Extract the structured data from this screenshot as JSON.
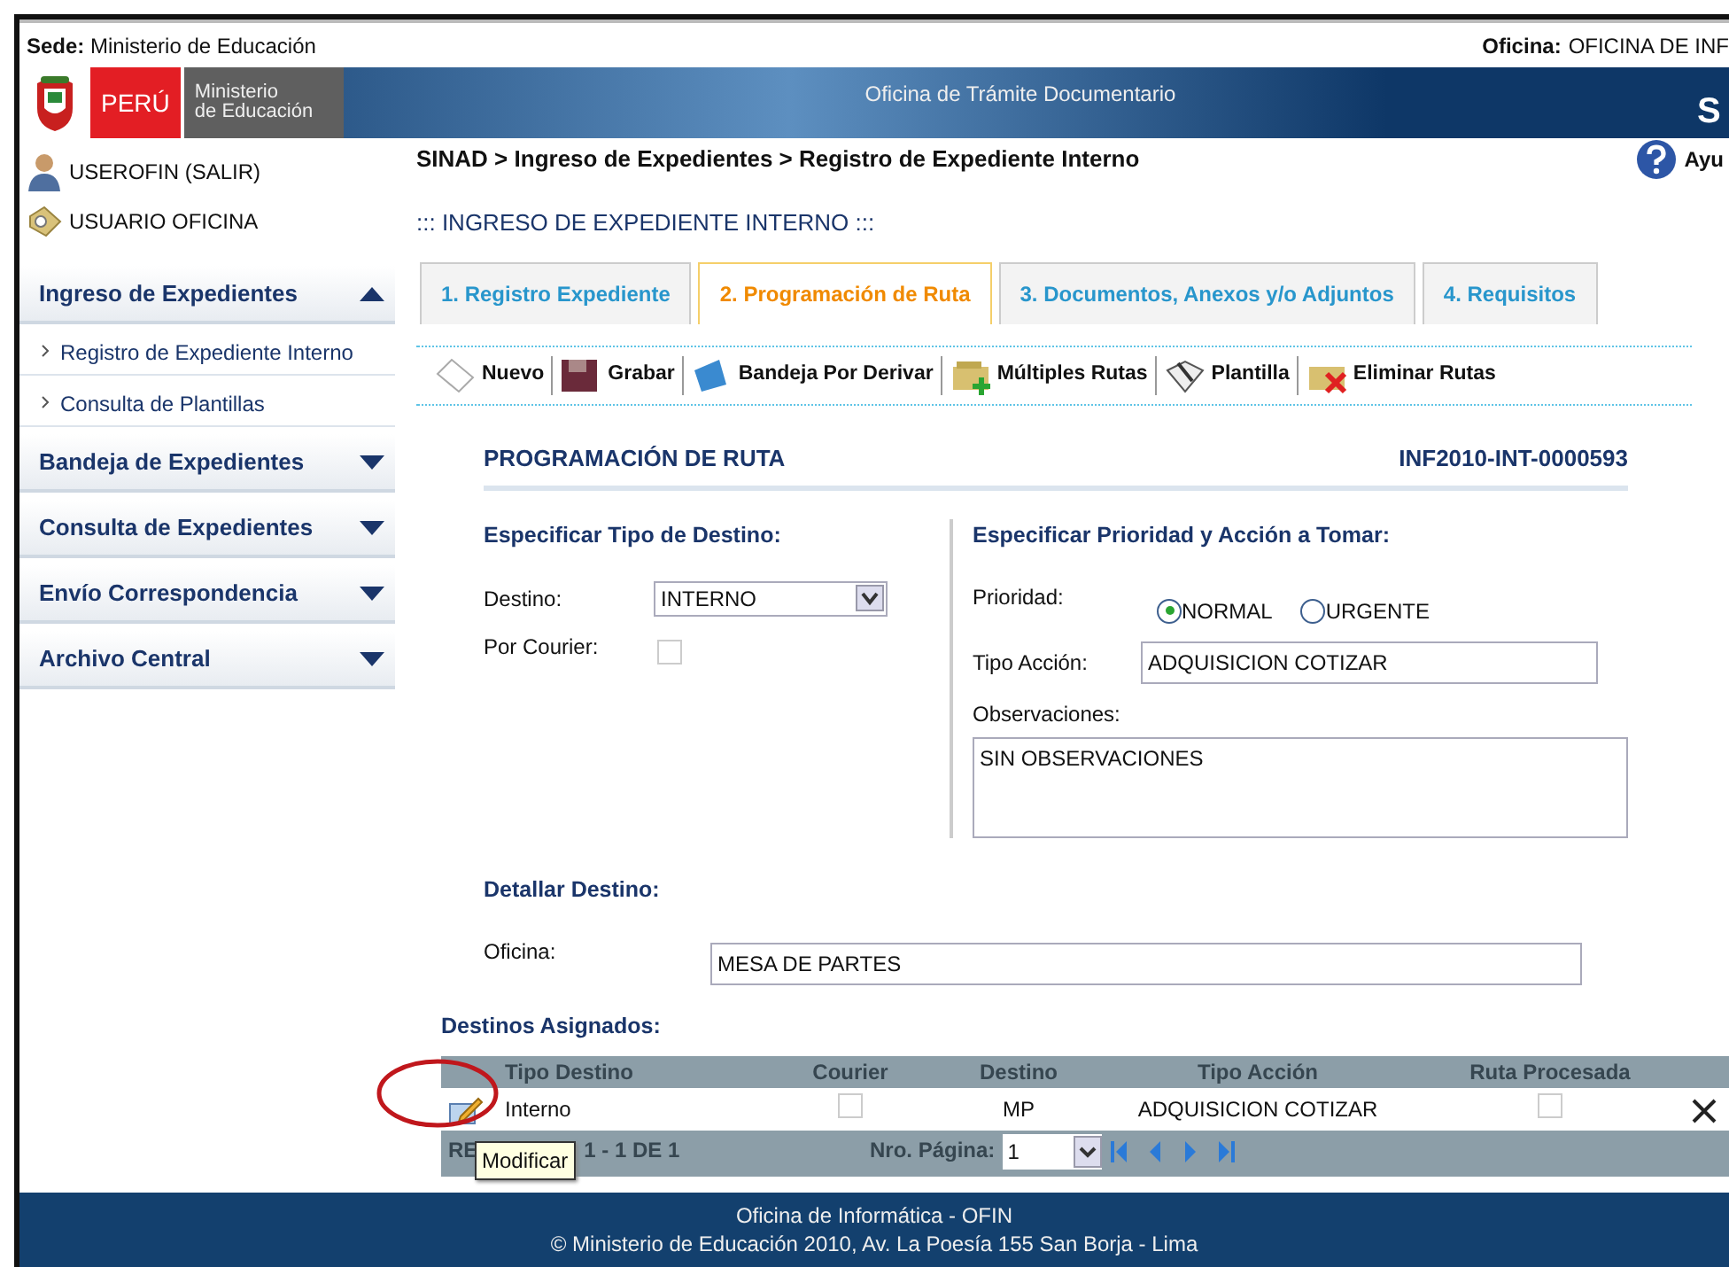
{
  "topbar": {
    "sede_label": "Sede:",
    "sede_value": "Ministerio de Educación",
    "oficina_label": "Oficina:",
    "oficina_value": "OFICINA DE INF"
  },
  "banner": {
    "country": "PERÚ",
    "ministry": [
      "Ministerio",
      "de Educación"
    ],
    "app_title": "Oficina de Trámite Documentario",
    "logo_letter": "S"
  },
  "sidebar": {
    "user_link": "USEROFIN (SALIR)",
    "role": "USUARIO OFICINA",
    "menu": [
      {
        "label": "Ingreso de Expedientes",
        "expanded": true,
        "children": [
          {
            "label": "Registro de Expediente Interno"
          },
          {
            "label": "Consulta de Plantillas"
          }
        ]
      },
      {
        "label": "Bandeja de Expedientes",
        "expanded": false
      },
      {
        "label": "Consulta de Expedientes",
        "expanded": false
      },
      {
        "label": "Envío Correspondencia",
        "expanded": false
      },
      {
        "label": "Archivo Central",
        "expanded": false
      }
    ]
  },
  "breadcrumb": "SINAD > Ingreso de Expedientes > Registro de Expediente Interno",
  "help_label": "Ayu",
  "page_title": "::: INGRESO DE EXPEDIENTE INTERNO :::",
  "tabs": [
    {
      "label": "1. Registro Expediente",
      "selected": false
    },
    {
      "label": "2. Programación de Ruta",
      "selected": true
    },
    {
      "label": "3. Documentos, Anexos y/o Adjuntos",
      "selected": false
    },
    {
      "label": "4. Requisitos",
      "selected": false
    }
  ],
  "toolbar": [
    {
      "kind": "new",
      "label": "Nuevo"
    },
    {
      "kind": "save",
      "label": "Grabar"
    },
    {
      "kind": "tray",
      "label": "Bandeja Por Derivar"
    },
    {
      "kind": "routes",
      "label": "Múltiples Rutas"
    },
    {
      "kind": "template",
      "label": "Plantilla"
    },
    {
      "kind": "delete",
      "label": "Eliminar Rutas"
    }
  ],
  "form": {
    "title": "PROGRAMACIÓN DE RUTA",
    "code": "INF2010-INT-0000593",
    "destino": {
      "heading": "Especificar Tipo de Destino:",
      "destino_label": "Destino:",
      "destino_value": "INTERNO",
      "courier_label": "Por Courier:",
      "courier_checked": false
    },
    "prioridad": {
      "heading": "Especificar Prioridad y Acción a Tomar:",
      "label": "Prioridad:",
      "options": [
        {
          "label": "NORMAL",
          "selected": true
        },
        {
          "label": "URGENTE",
          "selected": false
        }
      ],
      "accion_label": "Tipo Acción:",
      "accion_value": "ADQUISICION COTIZAR",
      "obs_label": "Observaciones:",
      "obs_value": "SIN OBSERVACIONES"
    },
    "detalle": {
      "heading": "Detallar Destino:",
      "oficina_label": "Oficina:",
      "oficina_value": "MESA DE PARTES"
    }
  },
  "table": {
    "title": "Destinos Asignados:",
    "columns": [
      "Tipo Destino",
      "Courier",
      "Destino",
      "Tipo Acción",
      "Ruta Procesada"
    ],
    "rows": [
      {
        "tipo": "Interno",
        "courier": false,
        "destino": "MP",
        "accion": "ADQUISICION COTIZAR",
        "ruta_procesada": false
      }
    ],
    "records_visible": [
      "RE",
      "1 - 1 DE 1"
    ],
    "page_label": "Nro. Página:",
    "page_value": "1",
    "tooltip": "Modificar"
  },
  "footer": [
    "Oficina de Informática - OFIN",
    "© Ministerio de Educación 2010, Av. La Poesía 155 San Borja - Lima"
  ]
}
